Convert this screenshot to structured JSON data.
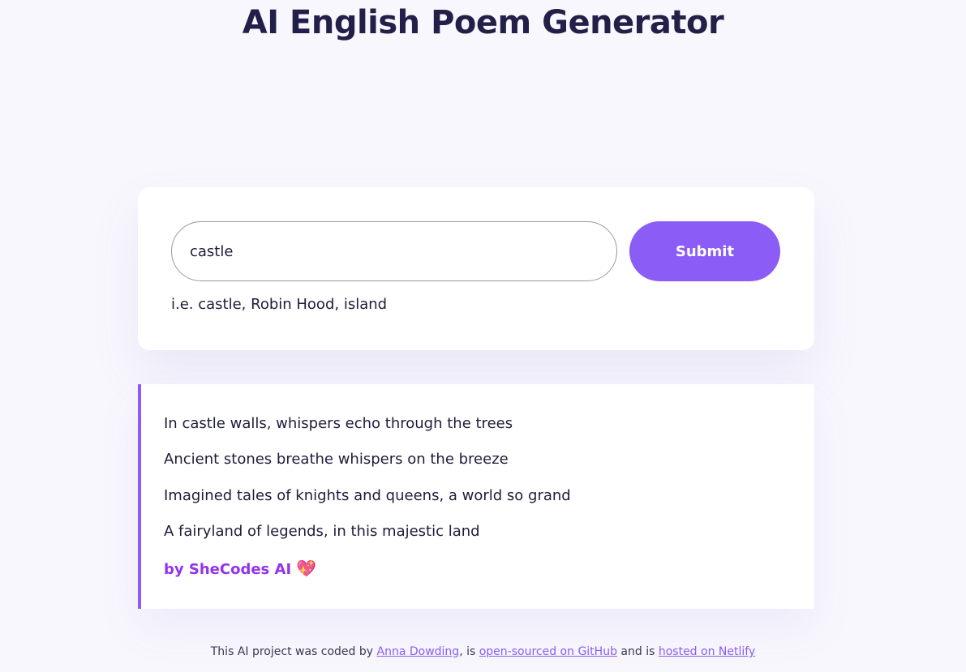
{
  "header": {
    "title": "AI English Poem Generator"
  },
  "form": {
    "input_value": "castle",
    "submit_label": "Submit",
    "hint": "i.e. castle, Robin Hood, island"
  },
  "poem": {
    "lines": [
      "In castle walls, whispers echo through the trees",
      "Ancient stones breathe whispers on the breeze",
      "Imagined tales of knights and queens, a world so grand",
      "A fairyland of legends, in this majestic land"
    ],
    "signature": "by SheCodes AI",
    "signature_icon": "sparkling-heart-icon",
    "heart_glyph": "💖"
  },
  "footer": {
    "text_1": "This AI project was coded by ",
    "author_link": "Anna Dowding",
    "text_2": ", is ",
    "github_link": "open-sourced on GitHub",
    "text_3": " and is ",
    "netlify_link": "hosted on Netlify"
  },
  "colors": {
    "accent": "#8b5cf6",
    "signature": "#9333ea",
    "background": "#f8f7fd",
    "title": "#221f48"
  }
}
